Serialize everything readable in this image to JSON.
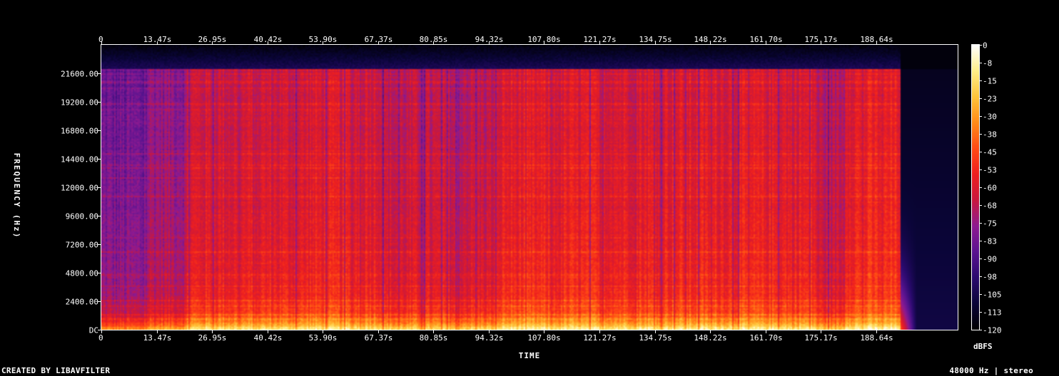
{
  "credit": "CREATED BY LIBAVFILTER",
  "format": "48000 Hz | stereo",
  "colors": {
    "background": "#000000",
    "frame": "#ffffff",
    "palette": [
      "#000000",
      "#0a0538",
      "#2a0a6e",
      "#5a1490",
      "#8e1a90",
      "#c8183e",
      "#ee1f1f",
      "#ff4a14",
      "#ff8a18",
      "#ffc43a",
      "#ffee88",
      "#ffffff"
    ]
  },
  "chart_data": {
    "type": "heatmap",
    "xlabel": "TIME",
    "ylabel": "FREQUENCY (Hz)",
    "colorbar_label": "dBFS",
    "x_ticks": [
      "0",
      "13.47s",
      "26.95s",
      "40.42s",
      "53.90s",
      "67.37s",
      "80.85s",
      "94.32s",
      "107.80s",
      "121.27s",
      "134.75s",
      "148.22s",
      "161.70s",
      "175.17s",
      "188.64s"
    ],
    "x_tick_values": [
      0,
      13.47,
      26.95,
      40.42,
      53.9,
      67.37,
      80.85,
      94.32,
      107.8,
      121.27,
      134.75,
      148.22,
      161.7,
      175.17,
      188.64
    ],
    "xlim": [
      0,
      208.5
    ],
    "y_ticks": [
      "DC",
      "2400.00",
      "4800.00",
      "7200.00",
      "9600.00",
      "12000.00",
      "14400.00",
      "16800.00",
      "19200.00",
      "21600.00"
    ],
    "y_tick_values": [
      0,
      2400,
      4800,
      7200,
      9600,
      12000,
      14400,
      16800,
      19200,
      21600
    ],
    "ylim": [
      0,
      24000
    ],
    "colorbar_ticks": [
      "0",
      "-8",
      "-15",
      "-23",
      "-30",
      "-38",
      "-45",
      "-53",
      "-60",
      "-68",
      "-75",
      "-83",
      "-90",
      "-98",
      "-105",
      "-113",
      "-120"
    ],
    "colorbar_range": [
      -120,
      0
    ],
    "audio_end": 194.5,
    "cutoff_freq": 22000,
    "segments": [
      {
        "t0": 0,
        "t1": 10,
        "level": -78
      },
      {
        "t0": 10,
        "t1": 21,
        "level": -70
      },
      {
        "t0": 21,
        "t1": 50,
        "level": -58
      },
      {
        "t0": 50,
        "t1": 68,
        "level": -56
      },
      {
        "t0": 68,
        "t1": 97,
        "level": -62
      },
      {
        "t0": 97,
        "t1": 174,
        "level": -55
      },
      {
        "t0": 174,
        "t1": 181,
        "level": -64
      },
      {
        "t0": 181,
        "t1": 194.5,
        "level": -52
      }
    ]
  }
}
